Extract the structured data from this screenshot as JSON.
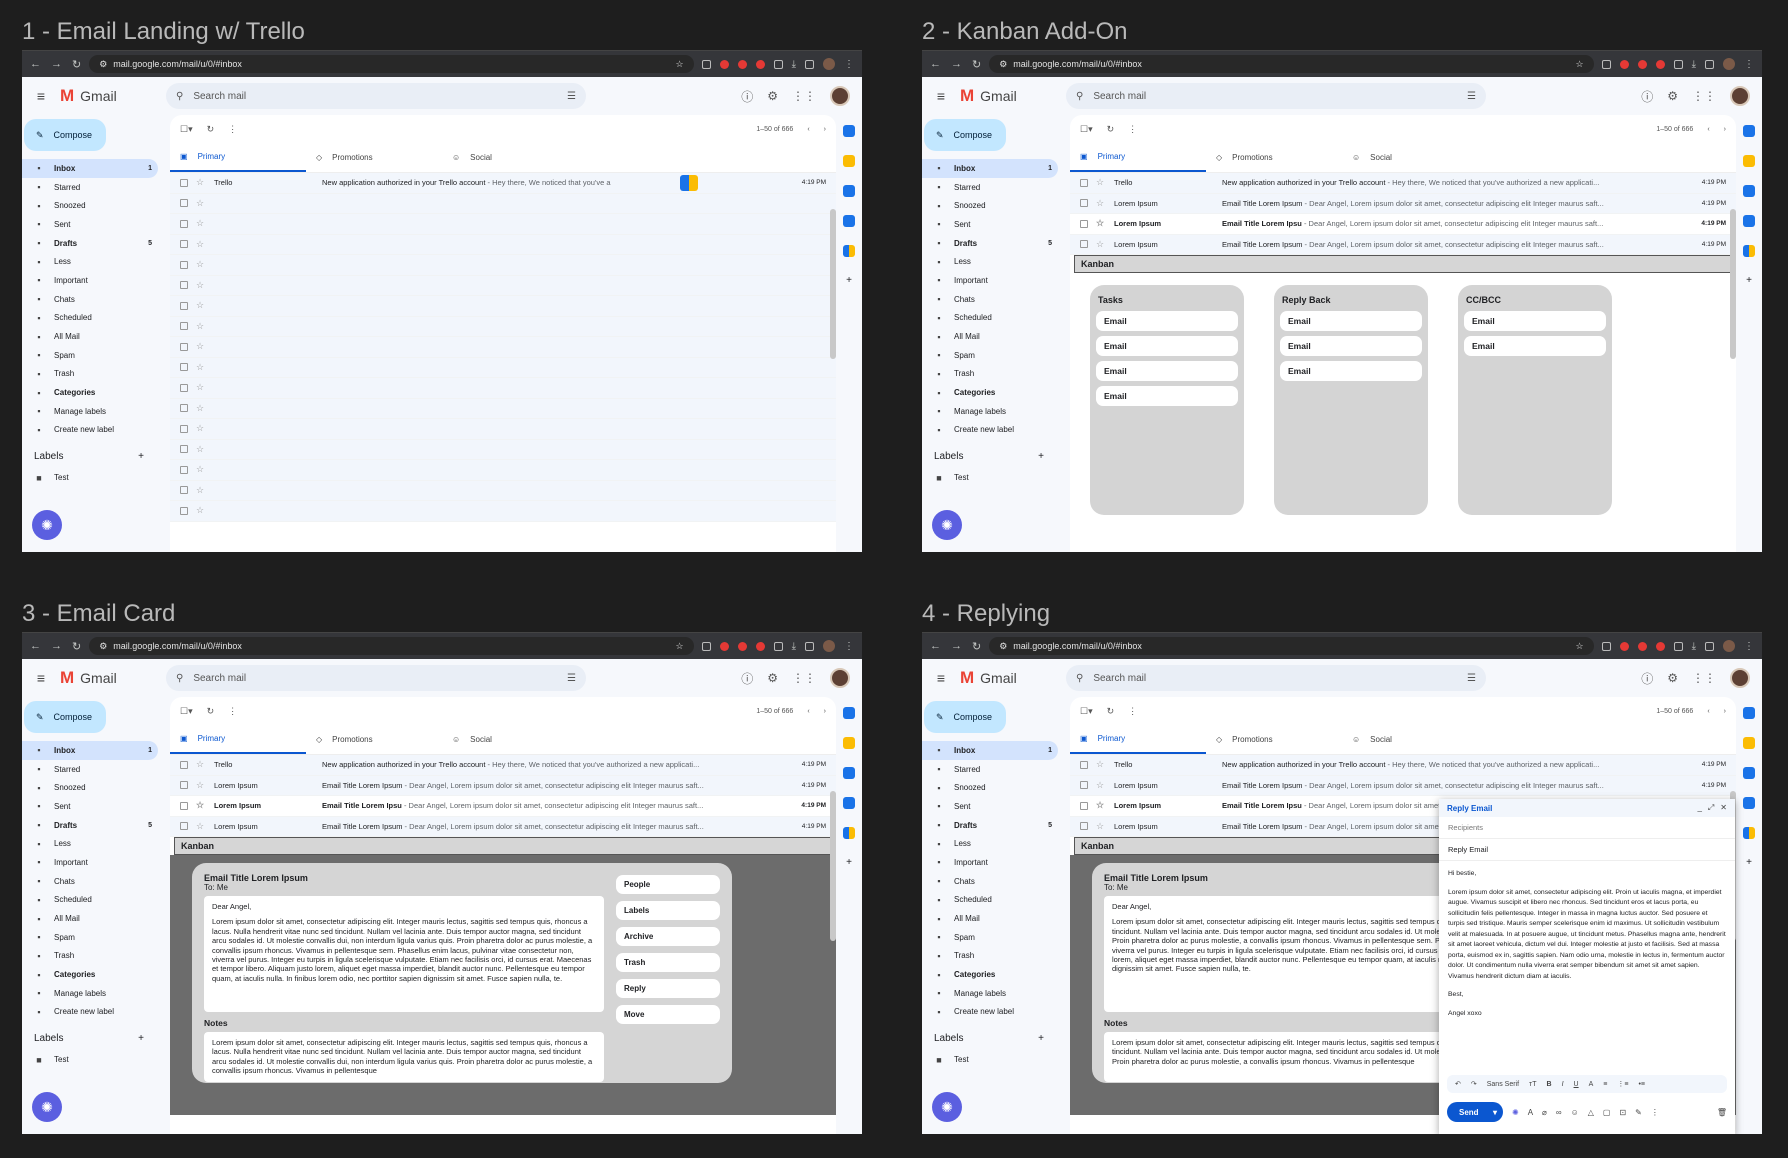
{
  "panels": [
    {
      "title": "1 - Email Landing w/ Trello"
    },
    {
      "title": "2 - Kanban Add-On"
    },
    {
      "title": "3 - Email Card"
    },
    {
      "title": "4 - Replying"
    }
  ],
  "browser": {
    "url": "mail.google.com/mail/u/0/#inbox"
  },
  "gmail": {
    "app_name": "Gmail",
    "search_placeholder": "Search mail",
    "compose": "Compose",
    "pagination": "1–50 of 666",
    "tabs": [
      "Primary",
      "Promotions",
      "Social"
    ],
    "nav": [
      {
        "label": "Inbox",
        "count": "1",
        "icon": "inbox-icon"
      },
      {
        "label": "Starred",
        "count": "",
        "icon": "star-icon"
      },
      {
        "label": "Snoozed",
        "count": "",
        "icon": "clock-icon"
      },
      {
        "label": "Sent",
        "count": "",
        "icon": "send-icon"
      },
      {
        "label": "Drafts",
        "count": "5",
        "icon": "draft-icon"
      },
      {
        "label": "Less",
        "count": "",
        "icon": "chevron-up-icon"
      },
      {
        "label": "Important",
        "count": "",
        "icon": "important-icon"
      },
      {
        "label": "Chats",
        "count": "",
        "icon": "chat-icon"
      },
      {
        "label": "Scheduled",
        "count": "",
        "icon": "scheduled-icon"
      },
      {
        "label": "All Mail",
        "count": "",
        "icon": "all-mail-icon"
      },
      {
        "label": "Spam",
        "count": "",
        "icon": "spam-icon"
      },
      {
        "label": "Trash",
        "count": "",
        "icon": "trash-icon"
      },
      {
        "label": "Categories",
        "count": "",
        "icon": "label-icon"
      },
      {
        "label": "Manage labels",
        "count": "",
        "icon": "gear-icon"
      },
      {
        "label": "Create new label",
        "count": "",
        "icon": "plus-icon"
      }
    ],
    "labels_heading": "Labels",
    "labels": [
      "Test"
    ]
  },
  "emails_p1": [
    {
      "from": "Trello",
      "subject": "New application authorized in your Trello account",
      "snippet": " - Hey there, We noticed that you've a",
      "time": "4:19 PM"
    }
  ],
  "emails": [
    {
      "from": "Trello",
      "subject": "New application authorized in your Trello account",
      "snippet": " - Hey there, We noticed that you've authorized a new applicati...",
      "time": "4:19 PM",
      "unread": false
    },
    {
      "from": "Lorem Ipsum",
      "subject": "Email Title Lorem Ipsum",
      "snippet": " - Dear Angel, Lorem ipsum dolor sit amet, consectetur adipiscing elit Integer maurus saft...",
      "time": "4:19 PM",
      "unread": false
    },
    {
      "from": "Lorem Ipsum",
      "subject": "Email Title Lorem Ipsu",
      "snippet": " - Dear Angel, Lorem ipsum dolor sit amet, consectetur adipiscing elit Integer maurus saft...",
      "time": "4:19 PM",
      "unread": true
    },
    {
      "from": "Lorem Ipsum",
      "subject": "Email Title Lorem Ipsum",
      "snippet": " - Dear Angel, Lorem ipsum dolor sit amet, consectetur adipiscing elit Integer maurus saft...",
      "time": "4:19 PM",
      "unread": false
    }
  ],
  "kanban": {
    "title": "Kanban",
    "columns": [
      {
        "name": "Tasks",
        "cards": [
          "Email",
          "Email",
          "Email",
          "Email"
        ]
      },
      {
        "name": "Reply Back",
        "cards": [
          "Email",
          "Email",
          "Email"
        ]
      },
      {
        "name": "CC/BCC",
        "cards": [
          "Email",
          "Email"
        ]
      }
    ]
  },
  "email_card": {
    "title": "Email Title Lorem Ipsum",
    "to": "To: Me",
    "greeting": "Dear Angel,",
    "body": "Lorem ipsum dolor sit amet, consectetur adipiscing elit. Integer mauris lectus, sagittis sed tempus quis, rhoncus a lacus. Nulla hendrerit vitae nunc sed tincidunt. Nullam vel lacinia ante. Duis tempor auctor magna, sed tincidunt arcu sodales id. Ut molestie convallis dui, non interdum ligula varius quis. Proin pharetra dolor ac purus molestie, a convallis ipsum rhoncus. Vivamus in pellentesque sem. Phasellus enim lacus, pulvinar vitae consectetur non, viverra vel purus. Integer eu turpis in ligula scelerisque vulputate. Etiam nec facilisis orci, id cursus erat. Maecenas et tempor libero. Aliquam justo lorem, aliquet eget massa imperdiet, blandit auctor nunc. Pellentesque eu tempor quam, at iaculis nulla. In finibus lorem odio, nec porttitor sapien dignissim sit amet. Fusce sapien nulla, te.",
    "notes_heading": "Notes",
    "notes": "Lorem ipsum dolor sit amet, consectetur adipiscing elit. Integer mauris lectus, sagittis sed tempus quis, rhoncus a lacus. Nulla hendrerit vitae nunc sed tincidunt. Nullam vel lacinia ante. Duis tempor auctor magna, sed tincidunt arcu sodales id. Ut molestie convallis dui, non interdum ligula varius quis. Proin pharetra dolor ac purus molestie, a convallis ipsum rhoncus. Vivamus in pellentesque",
    "actions": [
      "People",
      "Labels",
      "Archive",
      "Trash",
      "Reply",
      "Move"
    ]
  },
  "reply": {
    "header": "Reply Email",
    "recipients_placeholder": "Recipients",
    "subject": "Reply Email",
    "greeting": "Hi bestie,",
    "body": "Lorem ipsum dolor sit amet, consectetur adipiscing elit. Proin ut iaculis magna, et imperdiet augue. Vivamus suscipit et libero nec rhoncus. Sed tincidunt eros et lacus porta, eu sollicitudin felis pellentesque. Integer in massa in magna luctus auctor. Sed posuere et turpis sed tristique. Mauris semper scelerisque enim id maximus. Ut sollicitudin vestibulum velit at malesuada. In at posuere augue, ut tincidunt metus. Phasellus magna ante, hendrerit sit amet laoreet vehicula, dictum vel dui. Integer molestie at justo et facilisis. Sed at massa porta, euismod ex in, sagittis sapien. Nam odio urna, molestie in lectus in, fermentum auctor dolor. Ut condimentum nulla viverra erat semper bibendum sit amet sit amet sapien. Vivamus hendrerit dictum diam at iaculis.",
    "signoff": "Best,",
    "signature": "Angel xoxo",
    "font": "Sans Serif",
    "send": "Send"
  }
}
